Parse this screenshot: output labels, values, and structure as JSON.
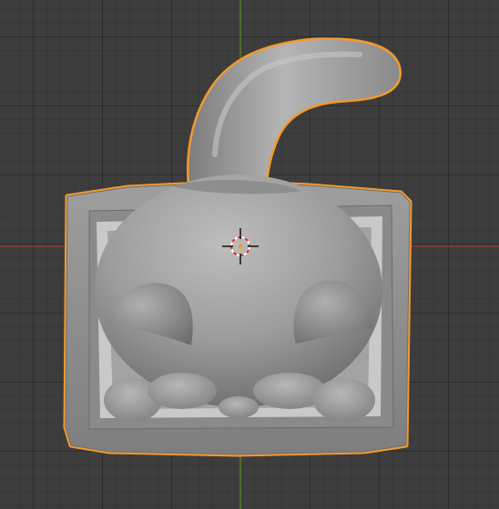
{
  "viewport": {
    "background": "#3d3d3d",
    "x_axis_color": "#9a3a3a",
    "y_axis_color": "#5f8f2e"
  },
  "object": {
    "name": "",
    "selected": true,
    "outline_color": "#f29a2e",
    "body_color": "#9b9b9b"
  },
  "cursor_3d": {
    "icon": "3d-cursor-icon",
    "ring_red": "#d83a2c",
    "ring_white": "#ffffff"
  }
}
